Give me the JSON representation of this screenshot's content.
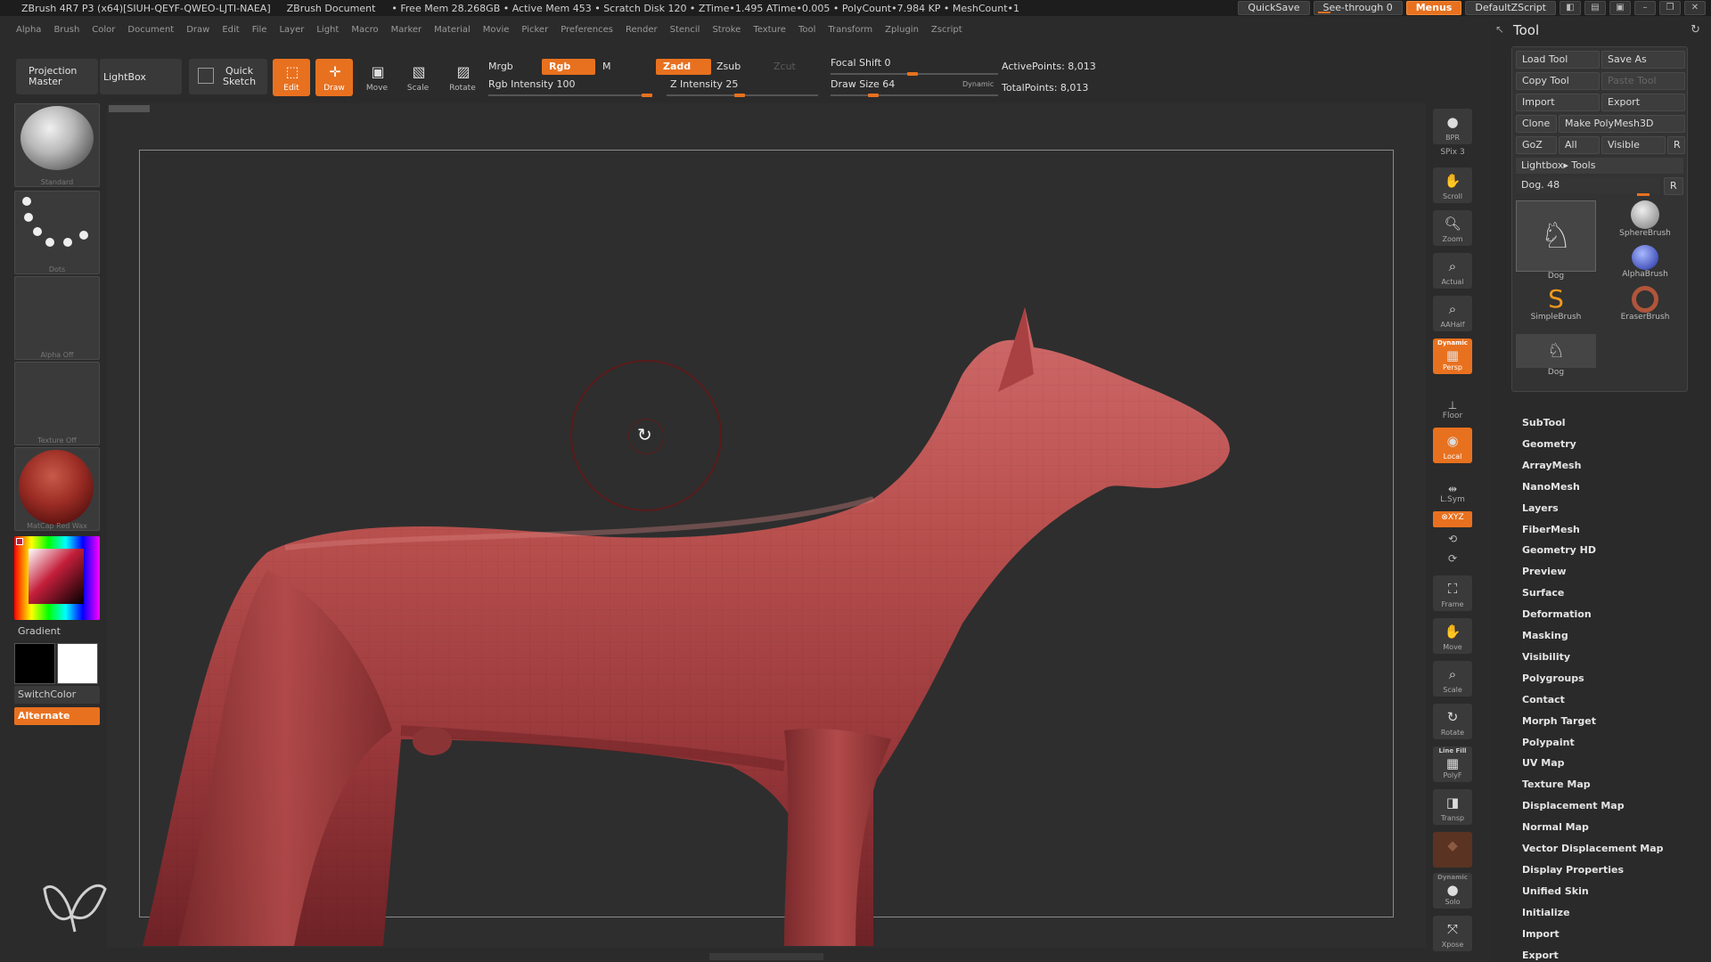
{
  "titlebar": {
    "app": "ZBrush 4R7 P3 (x64)[SIUH-QEYF-QWEO-LJTI-NAEA]",
    "doc": "ZBrush Document",
    "stats": "• Free Mem 28.268GB • Active Mem 453 • Scratch Disk 120 •  ZTime•1.495 ATime•0.005 • PolyCount•7.984 KP  • MeshCount•1",
    "quicksave": "QuickSave",
    "seethrough": "See-through   0",
    "menus": "Menus",
    "script": "DefaultZScript"
  },
  "menubar": [
    "Alpha",
    "Brush",
    "Color",
    "Document",
    "Draw",
    "Edit",
    "File",
    "Layer",
    "Light",
    "Macro",
    "Marker",
    "Material",
    "Movie",
    "Picker",
    "Preferences",
    "Render",
    "Stencil",
    "Stroke",
    "Texture",
    "Tool",
    "Transform",
    "Zplugin",
    "Zscript"
  ],
  "toolbar": {
    "projection_master_1": "Projection",
    "projection_master_2": "Master",
    "lightbox": "LightBox",
    "quick_sketch_1": "Quick",
    "quick_sketch_2": "Sketch",
    "edit": "Edit",
    "draw": "Draw",
    "move": "Move",
    "scale": "Scale",
    "rotate": "Rotate",
    "mrgb": "Mrgb",
    "rgb": "Rgb",
    "m": "M",
    "rgb_intensity": "Rgb Intensity 100",
    "zadd": "Zadd",
    "zsub": "Zsub",
    "zcut": "Zcut",
    "z_intensity": "Z Intensity 25",
    "focal_shift": "Focal Shift 0",
    "draw_size": "Draw Size 64",
    "dynamic": "Dynamic",
    "active_points": "ActivePoints: 8,013",
    "total_points": "TotalPoints: 8,013"
  },
  "left_shelf": {
    "brush": "Standard",
    "stroke": "Dots",
    "alpha": "Alpha  Off",
    "texture": "Texture  Off",
    "material": "MatCap  Red  Wax",
    "gradient": "Gradient",
    "switch_color": "SwitchColor",
    "alternate": "Alternate"
  },
  "right_shelf": {
    "bpr": "BPR",
    "spix": "SPix 3",
    "scroll": "Scroll",
    "zoom": "Zoom",
    "actual": "Actual",
    "aahalf": "AAHalf",
    "dynamic": "Dynamic",
    "persp": "Persp",
    "floor": "Floor",
    "local": "Local",
    "lsym": "L.Sym",
    "xyz": "⊗XYZ",
    "frame": "Frame",
    "move": "Move",
    "scale": "Scale",
    "rotate": "Rotate",
    "line_fill": "Line Fill",
    "polyf": "PolyF",
    "transp": "Transp",
    "dynamic2": "Dynamic",
    "solo": "Solo",
    "xpose": "Xpose"
  },
  "tool_panel": {
    "title": "Tool",
    "load_tool": "Load Tool",
    "save_as": "Save As",
    "copy_tool": "Copy Tool",
    "paste_tool": "Paste Tool",
    "import": "Import",
    "export": "Export",
    "clone": "Clone",
    "make_polymesh": "Make PolyMesh3D",
    "goz": "GoZ",
    "all": "All",
    "visible": "Visible",
    "r": "R",
    "lightbox_tools": "Lightbox▸ Tools",
    "dog_slider": "Dog. 48",
    "r2": "R",
    "thumbs": [
      "Dog",
      "SphereBrush",
      "AlphaBrush",
      "SimpleBrush",
      "EraserBrush",
      "Dog"
    ],
    "subpalettes": [
      "SubTool",
      "Geometry",
      "ArrayMesh",
      "NanoMesh",
      "Layers",
      "FiberMesh",
      "Geometry HD",
      "Preview",
      "Surface",
      "Deformation",
      "Masking",
      "Visibility",
      "Polygroups",
      "Contact",
      "Morph Target",
      "Polypaint",
      "UV Map",
      "Texture Map",
      "Displacement Map",
      "Normal Map",
      "Vector Displacement Map",
      "Display Properties",
      "Unified Skin",
      "Initialize",
      "Import",
      "Export"
    ]
  },
  "colors": {
    "accent": "#e8711f",
    "model": "#b54a4a",
    "background": "#2b2b2b"
  }
}
